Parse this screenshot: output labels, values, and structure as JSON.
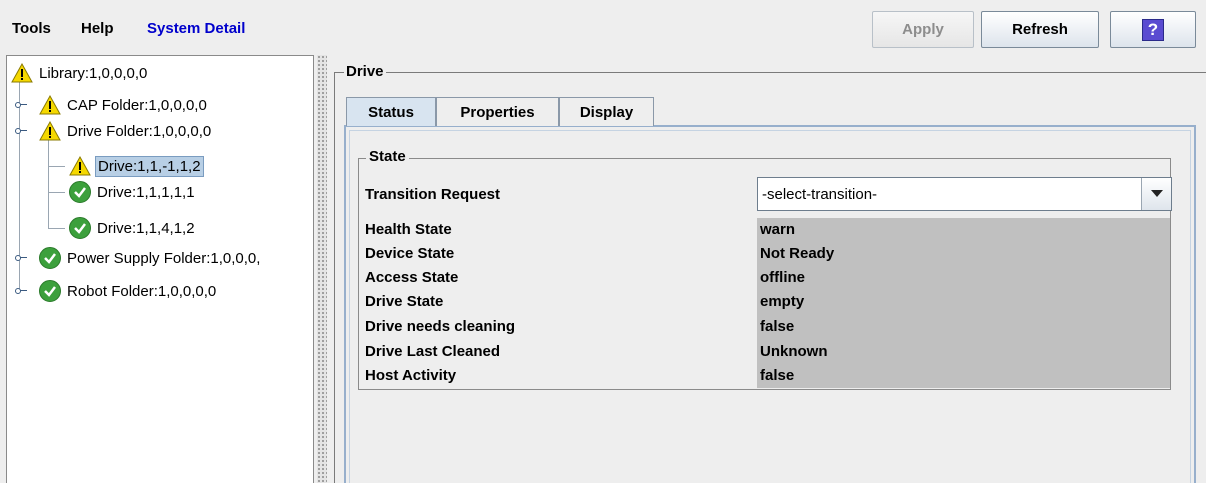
{
  "menu": {
    "tools": "Tools",
    "help": "Help",
    "system_detail": "System Detail"
  },
  "toolbar": {
    "apply": "Apply",
    "refresh": "Refresh",
    "help_icon": "?"
  },
  "tree": {
    "library": {
      "label": "Library:1,0,0,0,0",
      "icon": "warning-icon"
    },
    "cap_folder": {
      "label": "CAP Folder:1,0,0,0,0",
      "icon": "warning-icon"
    },
    "drive_folder": {
      "label": "Drive Folder:1,0,0,0,0",
      "icon": "warning-icon"
    },
    "drive_a": {
      "label": "Drive:1,1,-1,1,2",
      "icon": "warning-icon",
      "selected": true
    },
    "drive_b": {
      "label": "Drive:1,1,1,1,1",
      "icon": "ok-icon"
    },
    "drive_c": {
      "label": "Drive:1,1,4,1,2",
      "icon": "ok-icon"
    },
    "power_supply": {
      "label": "Power Supply Folder:1,0,0,0,",
      "icon": "ok-icon"
    },
    "robot": {
      "label": "Robot Folder:1,0,0,0,0",
      "icon": "ok-icon"
    }
  },
  "panel": {
    "title": "Drive",
    "tabs": [
      "Status",
      "Properties",
      "Display"
    ],
    "active_tab": "Status",
    "section_title": "State",
    "transition": {
      "label": "Transition Request",
      "value": "-select-transition-"
    },
    "rows": [
      {
        "label": "Health State",
        "value": "warn"
      },
      {
        "label": "Device State",
        "value": "Not Ready"
      },
      {
        "label": "Access State",
        "value": "offline"
      },
      {
        "label": "Drive State",
        "value": "empty"
      },
      {
        "label": "Drive needs cleaning",
        "value": "false"
      },
      {
        "label": "Drive Last Cleaned",
        "value": "Unknown"
      },
      {
        "label": "Host Activity",
        "value": "false"
      }
    ]
  },
  "colors": {
    "accent_link": "#0000cc",
    "selection": "#b8cfe5",
    "value_bg": "#c0c0c0",
    "ok_green": "#3ca03c",
    "warn_yellow": "#f5d800"
  }
}
